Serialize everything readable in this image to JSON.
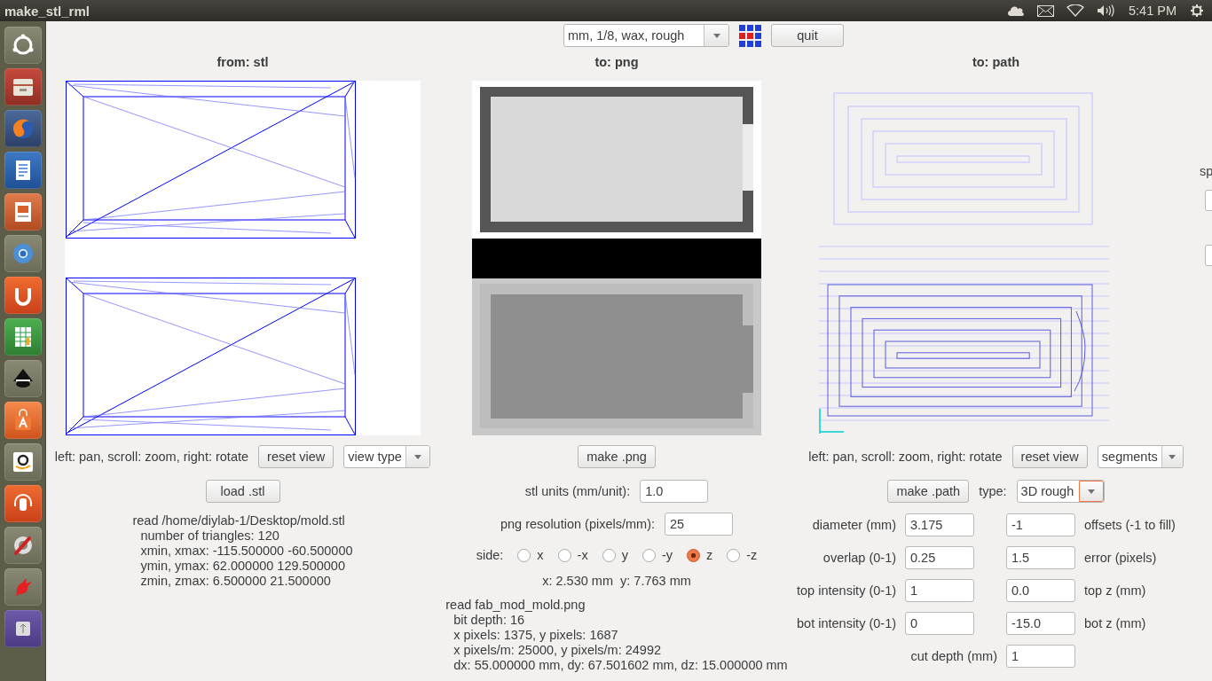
{
  "window": {
    "title": "make_stl_rml"
  },
  "top_panel": {
    "time": "5:41 PM"
  },
  "toolbar": {
    "machine": {
      "value": "mm, 1/8, wax, rough"
    },
    "quit_button": "quit"
  },
  "stl_panel": {
    "title": "from: stl",
    "hint": "left: pan, scroll: zoom, right: rotate",
    "reset_button": "reset view",
    "view_select": {
      "value": "view type"
    },
    "load_button": "load .stl",
    "info": {
      "heading": "read /home/diylab-1/Desktop/mold.stl",
      "lines": [
        "number of triangles: 120",
        "xmin, xmax: -115.500000 -60.500000",
        "ymin, ymax: 62.000000 129.500000",
        "zmin, zmax: 6.500000 21.500000"
      ]
    }
  },
  "png_panel": {
    "title": "to: png",
    "make_button": "make .png",
    "fields": [
      {
        "label": "stl units (mm/unit):",
        "value": "1.0"
      },
      {
        "label": "png resolution (pixels/mm):",
        "value": "25"
      }
    ],
    "side": {
      "label": "side:",
      "options": [
        {
          "label": "x",
          "selected": false
        },
        {
          "label": "-x",
          "selected": false
        },
        {
          "label": "y",
          "selected": false
        },
        {
          "label": "-y",
          "selected": false
        },
        {
          "label": "z",
          "selected": true
        },
        {
          "label": "-z",
          "selected": false
        }
      ]
    },
    "cursor": "x: 2.530 mm  y: 7.763 mm",
    "info": {
      "heading": "read fab_mod_mold.png",
      "lines": [
        "bit depth: 16",
        "x pixels: 1375, y pixels: 1687",
        "x pixels/m: 25000, y pixels/m: 24992",
        "dx: 55.000000 mm, dy: 67.501602 mm, dz: 15.000000 mm"
      ]
    }
  },
  "path_panel": {
    "title": "to: path",
    "hint": "left: pan, scroll: zoom, right: rotate",
    "reset_button": "reset view",
    "view_select": {
      "value": "segments"
    },
    "make_button": "make .path",
    "type": {
      "label": "type:",
      "value": "3D rough",
      "focused": true
    },
    "params": [
      {
        "left": {
          "label": "diameter (mm)",
          "value": "3.175"
        },
        "right": {
          "label": "offsets (-1 to fill)",
          "value": "-1"
        }
      },
      {
        "left": {
          "label": "overlap (0-1)",
          "value": "0.25"
        },
        "right": {
          "label": "error (pixels)",
          "value": "1.5"
        }
      },
      {
        "left": {
          "label": "top intensity (0-1)",
          "value": "1"
        },
        "right": {
          "label": "top z (mm)",
          "value": "0.0"
        }
      },
      {
        "left": {
          "label": "bot intensity (0-1)",
          "value": "0"
        },
        "right": {
          "label": "bot z (mm)",
          "value": "-15.0"
        }
      }
    ],
    "cut_depth": {
      "label": "cut depth (mm)",
      "value": "1"
    }
  },
  "right_edge": {
    "label": "sp"
  }
}
